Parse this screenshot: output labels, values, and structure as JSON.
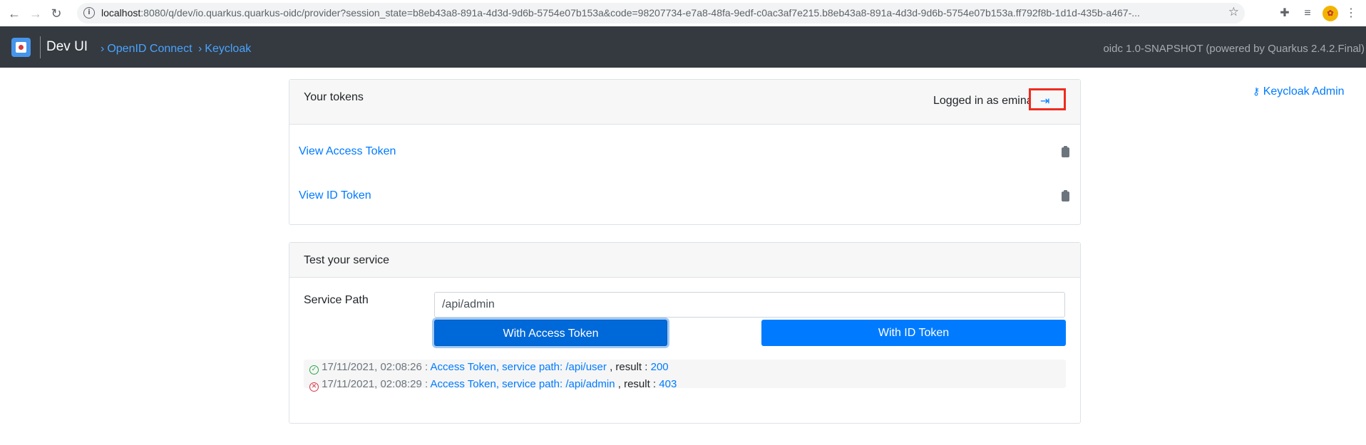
{
  "browser": {
    "url_host": "localhost",
    "url_rest": ":8080/q/dev/io.quarkus.quarkus-oidc/provider?session_state=b8eb43a8-891a-4d3d-9d6b-5754e07b153a&code=98207734-e7a8-48fa-9edf-c0ac3af7e215.b8eb43a8-891a-4d3d-9d6b-5754e07b153a.ff792f8b-1d1d-435b-a467-..."
  },
  "header": {
    "title": "Dev UI",
    "crumb1": "OpenID Connect",
    "crumb2": "Keycloak",
    "version": "oidc 1.0-SNAPSHOT (powered by Quarkus 2.4.2.Final)"
  },
  "tokens_card": {
    "title": "Your tokens",
    "logged_in": "Logged in as emina",
    "view_access": "View Access Token",
    "view_id": "View ID Token"
  },
  "keycloak_admin": "Keycloak Admin",
  "test_card": {
    "title": "Test your service",
    "service_path_label": "Service Path",
    "service_path_value": "/api/admin",
    "btn_access": "With Access Token",
    "btn_id": "With ID Token",
    "results": [
      {
        "status": "ok",
        "time": "17/11/2021, 02:08:26 :",
        "link": "Access Token, service path: /api/user",
        "result_label": ", result :",
        "code": "200"
      },
      {
        "status": "error",
        "time": "17/11/2021, 02:08:29 :",
        "link": "Access Token, service path: /api/admin",
        "result_label": ", result :",
        "code": "403"
      }
    ]
  },
  "colors": {
    "accent": "#007bff",
    "header_bg": "#343a40",
    "highlight_box": "#ef2b1f"
  }
}
